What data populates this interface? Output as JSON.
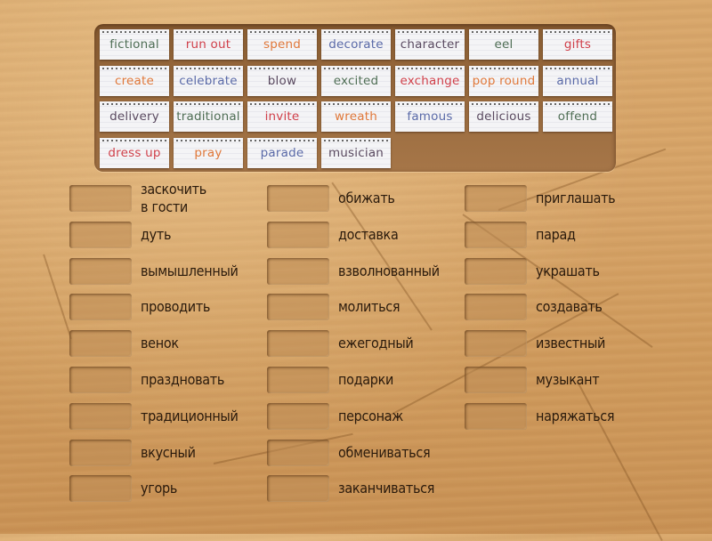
{
  "colors": {
    "green": "#4f6e55",
    "red": "#d0404a",
    "orange": "#e0783a",
    "blue": "#5a6aa8",
    "purple": "#5a4a60"
  },
  "cards": [
    {
      "text": "fictional",
      "color": "#4f6e55"
    },
    {
      "text": "run out",
      "color": "#d0404a"
    },
    {
      "text": "spend",
      "color": "#e0783a"
    },
    {
      "text": "decorate",
      "color": "#5a6aa8"
    },
    {
      "text": "character",
      "color": "#5a4a60"
    },
    {
      "text": "eel",
      "color": "#4f6e55"
    },
    {
      "text": "gifts",
      "color": "#d0404a"
    },
    {
      "text": "create",
      "color": "#e0783a"
    },
    {
      "text": "celebrate",
      "color": "#5a6aa8"
    },
    {
      "text": "blow",
      "color": "#5a4a60"
    },
    {
      "text": "excited",
      "color": "#4f6e55"
    },
    {
      "text": "exchange",
      "color": "#d0404a"
    },
    {
      "text": "pop round",
      "color": "#e0783a"
    },
    {
      "text": "annual",
      "color": "#5a6aa8"
    },
    {
      "text": "delivery",
      "color": "#5a4a60"
    },
    {
      "text": "traditional",
      "color": "#4f6e55"
    },
    {
      "text": "invite",
      "color": "#d0404a"
    },
    {
      "text": "wreath",
      "color": "#e0783a"
    },
    {
      "text": "famous",
      "color": "#5a6aa8"
    },
    {
      "text": "delicious",
      "color": "#5a4a60"
    },
    {
      "text": "offend",
      "color": "#4f6e55"
    },
    {
      "text": "dress up",
      "color": "#d0404a"
    },
    {
      "text": "pray",
      "color": "#e0783a"
    },
    {
      "text": "parade",
      "color": "#5a6aa8"
    },
    {
      "text": "musician",
      "color": "#5a4a60"
    }
  ],
  "targets": [
    [
      "заскочить\nв гости",
      "дуть",
      "вымышленный",
      "проводить",
      "венок",
      "праздновать",
      "традиционный",
      "вкусный",
      "угорь"
    ],
    [
      "обижать",
      "доставка",
      "взволнованный",
      "молиться",
      "ежегодный",
      "подарки",
      "персонаж",
      "обмениваться",
      "заканчиваться"
    ],
    [
      "приглашать",
      "парад",
      "украшать",
      "создавать",
      "известный",
      "музыкант",
      "наряжаться"
    ]
  ]
}
